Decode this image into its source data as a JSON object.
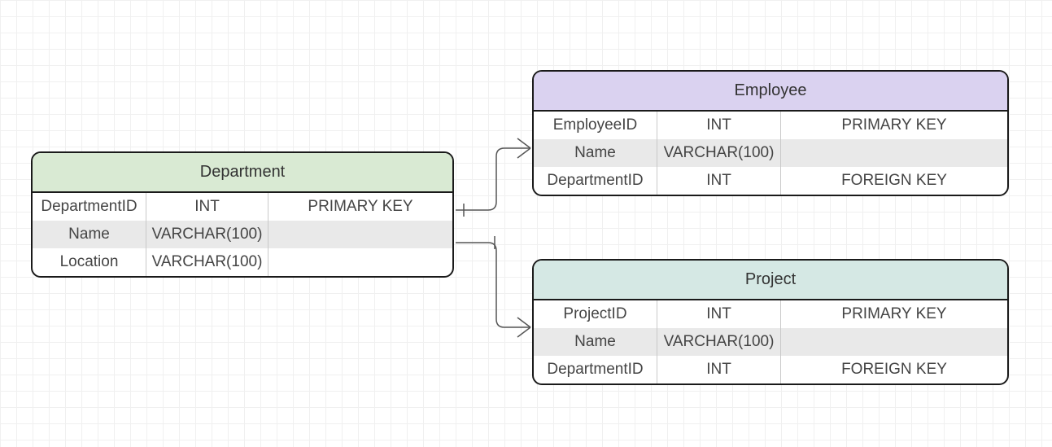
{
  "entities": {
    "department": {
      "title": "Department",
      "rows": [
        {
          "name": "DepartmentID",
          "type": "INT",
          "key": "PRIMARY KEY"
        },
        {
          "name": "Name",
          "type": "VARCHAR(100)",
          "key": ""
        },
        {
          "name": "Location",
          "type": "VARCHAR(100)",
          "key": ""
        }
      ]
    },
    "employee": {
      "title": "Employee",
      "rows": [
        {
          "name": "EmployeeID",
          "type": "INT",
          "key": "PRIMARY KEY"
        },
        {
          "name": "Name",
          "type": "VARCHAR(100)",
          "key": ""
        },
        {
          "name": "DepartmentID",
          "type": "INT",
          "key": "FOREIGN KEY"
        }
      ]
    },
    "project": {
      "title": "Project",
      "rows": [
        {
          "name": "ProjectID",
          "type": "INT",
          "key": "PRIMARY KEY"
        },
        {
          "name": "Name",
          "type": "VARCHAR(100)",
          "key": ""
        },
        {
          "name": "DepartmentID",
          "type": "INT",
          "key": "FOREIGN KEY"
        }
      ]
    }
  },
  "relations": [
    {
      "from": "department",
      "to": "employee",
      "type": "one-to-many"
    },
    {
      "from": "department",
      "to": "project",
      "type": "one-to-many"
    }
  ]
}
